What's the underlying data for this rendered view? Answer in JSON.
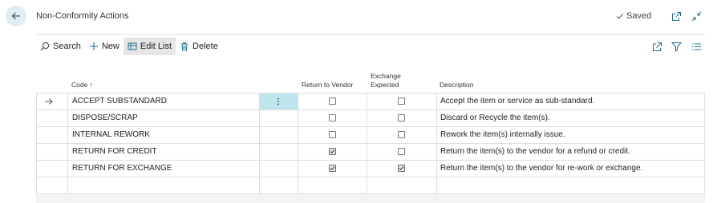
{
  "header": {
    "title": "Non-Conformity Actions",
    "saved_label": "Saved"
  },
  "toolbar": {
    "search_label": "Search",
    "new_label": "New",
    "edit_list_label": "Edit List",
    "delete_label": "Delete"
  },
  "columns": {
    "code": "Code ↑",
    "return_to_vendor": "Return to Vendor",
    "exchange_expected_line1": "Exchange",
    "exchange_expected_line2": "Expected",
    "description": "Description"
  },
  "rows": [
    {
      "code": "ACCEPT SUBSTANDARD",
      "return_to_vendor": false,
      "exchange_expected": false,
      "description": "Accept the item or service as sub-standard."
    },
    {
      "code": "DISPOSE/SCRAP",
      "return_to_vendor": false,
      "exchange_expected": false,
      "description": "Discard or Recycle the item(s)."
    },
    {
      "code": "INTERNAL REWORK",
      "return_to_vendor": false,
      "exchange_expected": false,
      "description": "Rework the item(s) internally issue."
    },
    {
      "code": "RETURN FOR CREDIT",
      "return_to_vendor": true,
      "exchange_expected": false,
      "description": "Return the item(s) to the vendor for a refund or credit."
    },
    {
      "code": "RETURN FOR EXCHANGE",
      "return_to_vendor": true,
      "exchange_expected": true,
      "description": "Return the item(s) to the vendor for re-work or exchange."
    }
  ],
  "icons": {
    "back": "arrow-left-icon",
    "saved": "checkmark-icon",
    "open_new_window": "open-in-new-window-icon",
    "collapse": "collapse-icon",
    "search": "search-icon",
    "new": "plus-icon",
    "edit_list": "edit-list-icon",
    "delete": "trash-icon",
    "share": "share-icon",
    "filter": "filter-icon",
    "list_view": "list-view-icon",
    "row_selected": "arrow-right-icon",
    "row_actions": "more-vertical-icon"
  },
  "colors": {
    "accent": "#1e6f8f",
    "selected_cell": "#bfe6ee",
    "back_button_bg": "#e1ecf4"
  }
}
